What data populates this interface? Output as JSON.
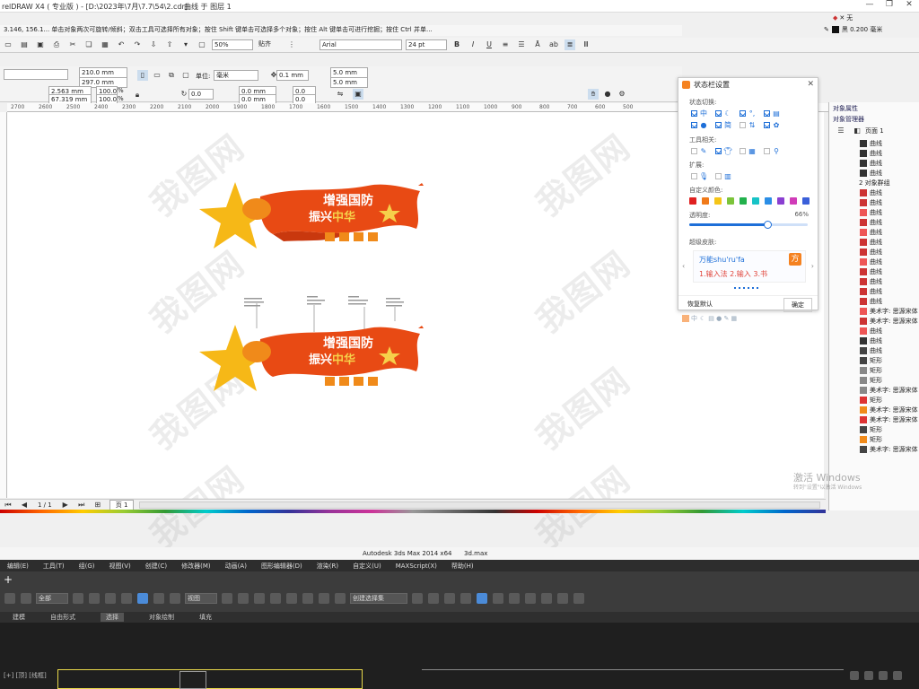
{
  "corel": {
    "title": "relDRAW X4 ( 专业版 ) - [D:\\2023年\\7月\\7.7\\54\\2.cdr]",
    "subtitle": "曲线 于 图层 1",
    "fill_label": "无",
    "outline_label": "黑 0.200 毫米",
    "status_hint": "3.146, 156.1...  单击对象两次可旋转/倾斜；双击工具可选择所有对象；按住 Shift 键单击可选择多个对象；按住 Alt 键单击可进行挖掘；按住 Ctrl 并单...",
    "toolbar": {
      "zoom": "50%",
      "snap": "贴齐",
      "font": "Arial",
      "font_size": "24 pt"
    },
    "props": {
      "width": "210.0 mm",
      "height": "297.0 mm",
      "x": "2.563 mm",
      "y": "67.319 mm",
      "scale_x": "100.0",
      "scale_y": "100.0",
      "pct": "%",
      "unit_label": "单位:",
      "unit_value": "毫米",
      "nudge": "0.1 mm",
      "dup_x": "5.0 mm",
      "dup_y": "5.0 mm",
      "angle": "0.0",
      "pos_a": "0.0 mm",
      "pos_b": "0.0 mm",
      "val_a": "0.0",
      "val_b": "0.0"
    },
    "ruler_ticks": [
      "2700",
      "2600",
      "2500",
      "2400",
      "2300",
      "2200",
      "2100",
      "2000",
      "1900",
      "1800",
      "1700",
      "1600",
      "1500",
      "1400",
      "1300",
      "1200",
      "1100",
      "1000",
      "900",
      "800",
      "700",
      "600",
      "500"
    ],
    "watermark": "我图网",
    "pagebar": {
      "counter": "1 / 1",
      "page_tab": "页 1"
    }
  },
  "banner": {
    "line1": "增强国防",
    "line2a": "振兴",
    "line2b": "中华"
  },
  "dialog": {
    "title": "状态栏设置",
    "section1": "状态切换:",
    "section2": "工具相关:",
    "section3": "扩展:",
    "section4": "自定义颜色:",
    "opacity_label": "透明度:",
    "opacity_value": "66%",
    "opacity": 0.66,
    "section5": "超级皮肤:",
    "skin_input": "万能shu'ru'fa",
    "skin_candidates": "1.输入法  2.输入  3.书",
    "reset": "恢复默认",
    "ok": "确定",
    "label_zhong": "中",
    "label_jian": "简",
    "colors": [
      "#e02020",
      "#f07a1a",
      "#f5c518",
      "#7cc43a",
      "#22b14c",
      "#17c3c6",
      "#2b8ee6",
      "#8a3fd1",
      "#d03bb8",
      "#3a5fd9"
    ]
  },
  "objmgr": {
    "tab1": "对象属性",
    "tab2": "对象管理器",
    "page": "页面 1",
    "group": "2 对象群组",
    "items": [
      "曲线",
      "曲线",
      "曲线",
      "曲线",
      "曲线",
      "曲线",
      "曲线",
      "曲线",
      "曲线",
      "曲线",
      "曲线",
      "曲线",
      "曲线",
      "曲线",
      "曲线",
      "曲线",
      "美术字: 思源宋体",
      "美术字: 思源宋体",
      "曲线",
      "曲线",
      "曲线",
      "矩形",
      "矩形",
      "矩形",
      "美术字: 思源宋体",
      "矩形",
      "美术字: 思源宋体",
      "美术字: 思源宋体",
      "矩形",
      "矩形",
      "美术字: 思源宋体"
    ],
    "activate": "激活 Windows",
    "activate_sub": "转到\"设置\"以激活 Windows"
  },
  "max": {
    "title": "Autodesk 3ds Max  2014 x64",
    "file": "3d.max",
    "menu": [
      "编辑(E)",
      "工具(T)",
      "组(G)",
      "视图(V)",
      "创建(C)",
      "修改器(M)",
      "动画(A)",
      "图形编辑器(D)",
      "渲染(R)",
      "自定义(U)",
      "MAXScript(X)",
      "帮助(H)"
    ],
    "select_filter": "全部",
    "view_mode": "视图",
    "set_placeholder": "创建选择集",
    "tabs": [
      "建模",
      "自由形式",
      "选择",
      "对象绘制",
      "填充"
    ],
    "viewport_label": "[+] [顶] [线框]",
    "plus": "+"
  }
}
